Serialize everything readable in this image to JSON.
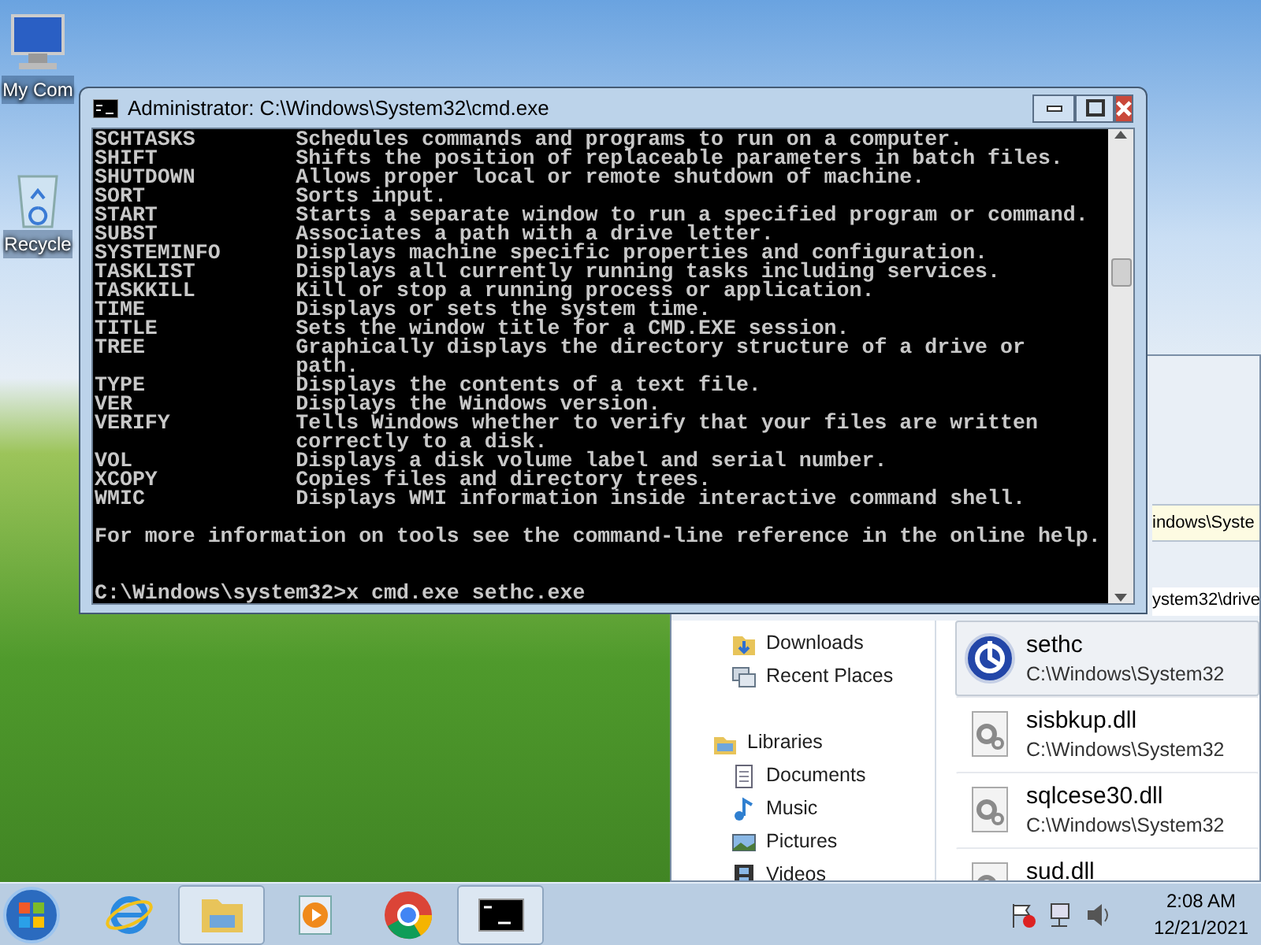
{
  "desktop_icons": [
    {
      "label": "My Com"
    },
    {
      "label": "Recycle"
    }
  ],
  "console": {
    "title": "Administrator: C:\\Windows\\System32\\cmd.exe",
    "lines": [
      "SCHTASKS        Schedules commands and programs to run on a computer.",
      "SHIFT           Shifts the position of replaceable parameters in batch files.",
      "SHUTDOWN        Allows proper local or remote shutdown of machine.",
      "SORT            Sorts input.",
      "START           Starts a separate window to run a specified program or command.",
      "SUBST           Associates a path with a drive letter.",
      "SYSTEMINFO      Displays machine specific properties and configuration.",
      "TASKLIST        Displays all currently running tasks including services.",
      "TASKKILL        Kill or stop a running process or application.",
      "TIME            Displays or sets the system time.",
      "TITLE           Sets the window title for a CMD.EXE session.",
      "TREE            Graphically displays the directory structure of a drive or",
      "                path.",
      "TYPE            Displays the contents of a text file.",
      "VER             Displays the Windows version.",
      "VERIFY          Tells Windows whether to verify that your files are written",
      "                correctly to a disk.",
      "VOL             Displays a disk volume label and serial number.",
      "XCOPY           Copies files and directory trees.",
      "WMIC            Displays WMI information inside interactive command shell."
    ],
    "footer": "For more information on tools see the command-line reference in the online help.",
    "prompt": "C:\\Windows\\system32>x cmd.exe sethc.exe"
  },
  "explorer": {
    "address": "indows\\Syste",
    "path_fragment": "ystem32\\drive",
    "favorites": [
      {
        "label": "Downloads",
        "kind": "downloads"
      },
      {
        "label": "Recent Places",
        "kind": "recent"
      }
    ],
    "libraries": {
      "label": "Libraries",
      "kind": "libraries",
      "children": [
        {
          "label": "Documents",
          "kind": "documents"
        },
        {
          "label": "Music",
          "kind": "music"
        },
        {
          "label": "Pictures",
          "kind": "pictures"
        },
        {
          "label": "Videos",
          "kind": "videos"
        }
      ]
    },
    "results": [
      {
        "name": "sethc",
        "path": "C:\\Windows\\System32",
        "kind": "app",
        "selected": true
      },
      {
        "name": "sisbkup.dll",
        "path": "C:\\Windows\\System32",
        "kind": "dll",
        "selected": false
      },
      {
        "name": "sqlcese30.dll",
        "path": "C:\\Windows\\System32",
        "kind": "dll",
        "selected": false
      },
      {
        "name": "sud.dll",
        "kind": "dll",
        "selected": false
      }
    ]
  },
  "taskbar": {
    "apps": [
      {
        "kind": "ie",
        "active": false
      },
      {
        "kind": "explorer",
        "active": true
      },
      {
        "kind": "media",
        "active": false
      },
      {
        "kind": "chrome",
        "active": false
      },
      {
        "kind": "cmd",
        "active": true
      }
    ],
    "time": "2:08 AM",
    "date": "12/21/2021"
  }
}
